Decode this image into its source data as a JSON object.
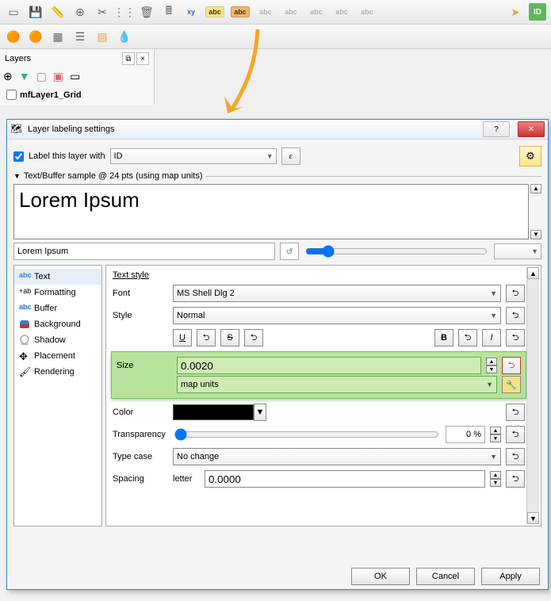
{
  "layers_panel": {
    "title": "Layers",
    "layer_name": "mfLayer1_Grid"
  },
  "dialog": {
    "title": "Layer labeling settings",
    "label_checkbox": "Label this layer with",
    "field": "ID",
    "epsilon": "ε",
    "sample_header": "Text/Buffer sample @ 24 pts (using map units)",
    "preview_big": "Lorem Ipsum",
    "preview_input": "Lorem Ipsum",
    "categories": [
      "Text",
      "Formatting",
      "Buffer",
      "Background",
      "Shadow",
      "Placement",
      "Rendering"
    ],
    "text_style": {
      "title": "Text style",
      "font_label": "Font",
      "font_value": "MS Shell Dlg 2",
      "style_label": "Style",
      "style_value": "Normal",
      "underline": "U",
      "strike": "S",
      "bold": "B",
      "italic": "I",
      "size_label": "Size",
      "size_value": "0.0020",
      "size_units": "map units",
      "color_label": "Color",
      "transparency_label": "Transparency",
      "transparency_value": "0 %",
      "typecase_label": "Type case",
      "typecase_value": "No change",
      "spacing_label": "Spacing",
      "spacing_kind": "letter",
      "spacing_value": "0.0000"
    },
    "buttons": {
      "ok": "OK",
      "cancel": "Cancel",
      "apply": "Apply"
    }
  }
}
